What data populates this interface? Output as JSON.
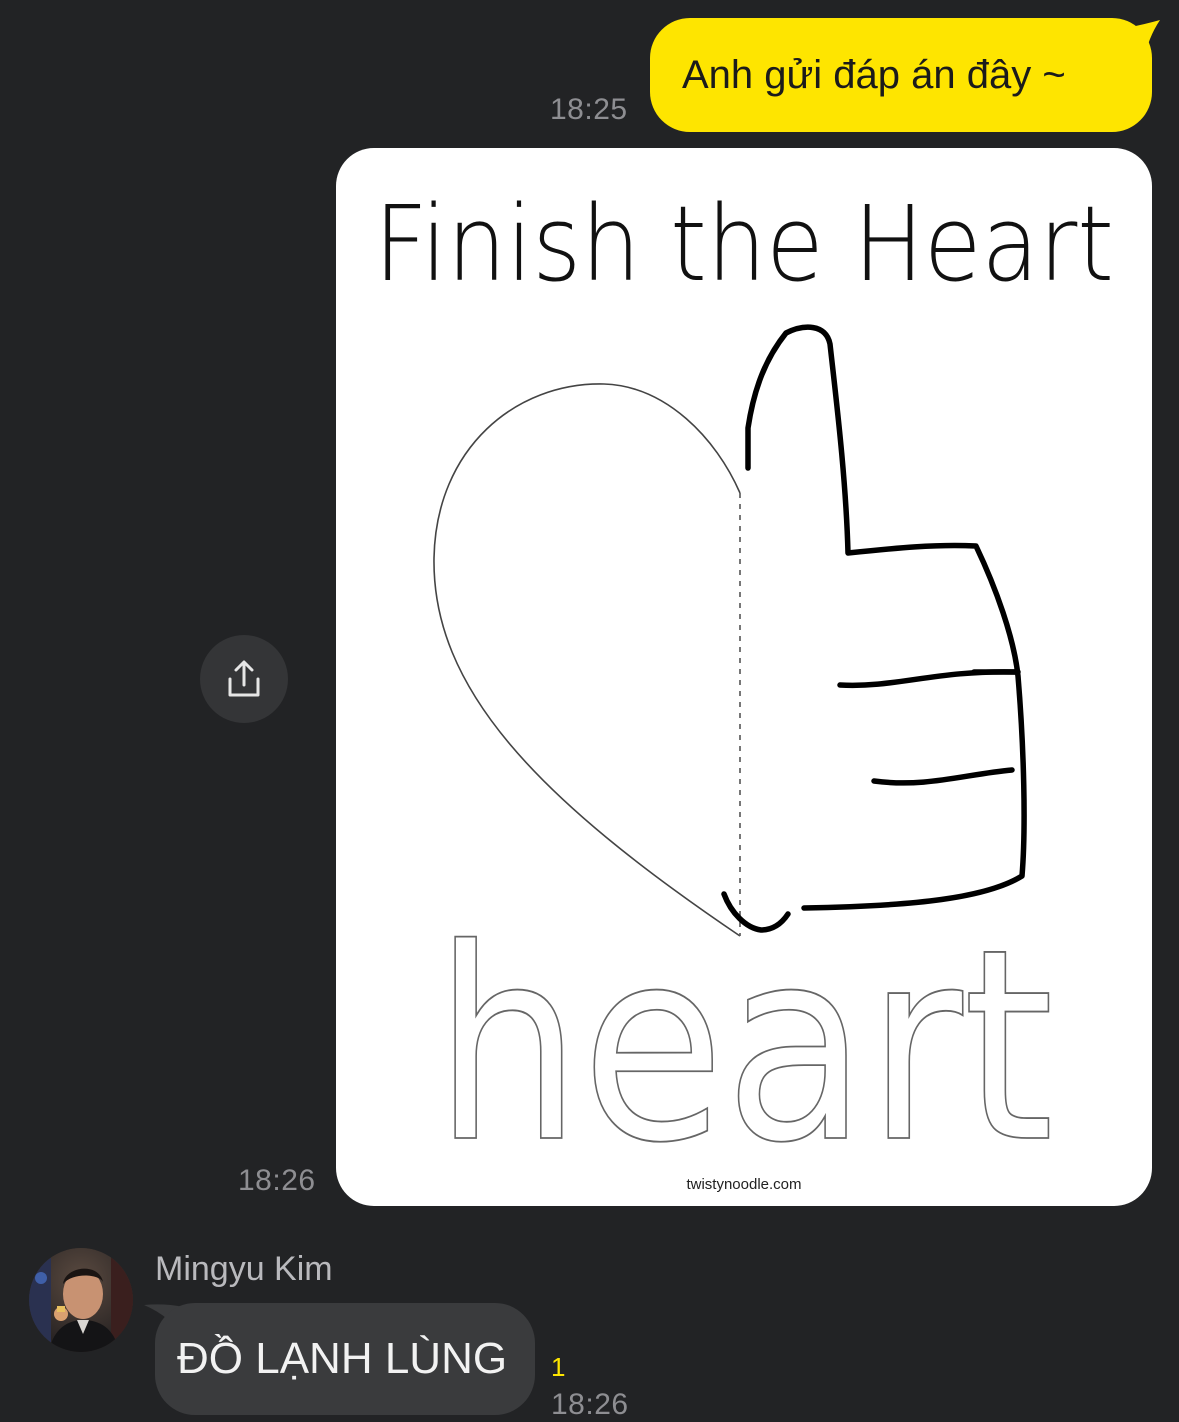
{
  "messages": {
    "outgoing_text": {
      "text": "Anh gửi đáp án đây ~",
      "time": "18:25"
    },
    "outgoing_image": {
      "time": "18:26",
      "worksheet": {
        "title": "Finish the Heart",
        "word": "heart",
        "watermark": "twistynoodle.com"
      }
    },
    "incoming": {
      "sender_name": "Mingyu Kim",
      "text": "ĐỒ LẠNH LÙNG",
      "unread_count": "1",
      "time": "18:26"
    }
  },
  "icons": {
    "share": "share-icon"
  },
  "colors": {
    "background": "#222325",
    "outgoing_bubble": "#fee500",
    "incoming_bubble": "#3a3b3d",
    "timestamp": "#8e8e92",
    "unread": "#fee500"
  }
}
